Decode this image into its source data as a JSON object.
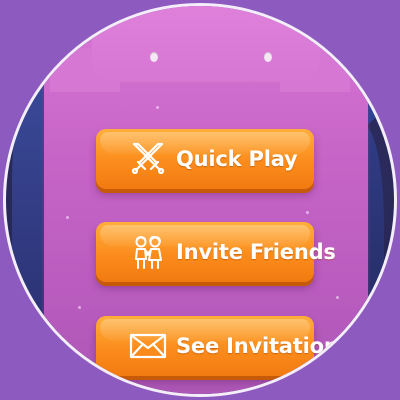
{
  "menu": {
    "buttons": [
      {
        "label": "Quick Play",
        "icon": "crossed-swords-icon"
      },
      {
        "label": "Invite Friends",
        "icon": "two-friends-icon"
      },
      {
        "label": "See Invitation",
        "icon": "envelope-icon"
      }
    ]
  },
  "colors": {
    "background": "#8d5bbf",
    "panel": "#c865c8",
    "button": "#fb8c1c",
    "button_shadow": "#c65a08",
    "label": "#ffffff",
    "frame_border": "#f4eefa"
  }
}
